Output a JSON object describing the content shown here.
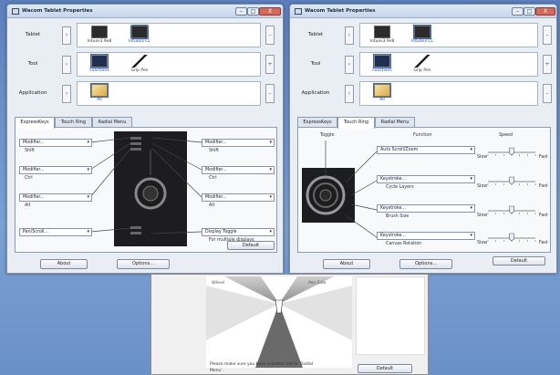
{
  "window_a": {
    "title": "Wacom Tablet Properties",
    "ctrl_min": "–",
    "ctrl_max": "□",
    "ctrl_close": "X",
    "row_labels": [
      "Tablet",
      "Tool",
      "Application"
    ],
    "tablet_items": [
      "Intuos3 9x8",
      "Intuos3 CL"
    ],
    "tool_items": [
      "Functions",
      "Grip Pen"
    ],
    "app_items": [
      "All"
    ],
    "tabs": [
      "ExpressKeys",
      "Touch Ring",
      "Radial Menu"
    ],
    "left_dropdowns": [
      {
        "value": "Modifier...",
        "sub": "Shift"
      },
      {
        "value": "Modifier...",
        "sub": "Ctrl"
      },
      {
        "value": "Modifier...",
        "sub": "Alt"
      },
      {
        "value": "Pan/Scroll...",
        "sub": ""
      }
    ],
    "right_dropdowns": [
      {
        "value": "Modifier...",
        "sub": "Shift"
      },
      {
        "value": "Modifier...",
        "sub": "Ctrl"
      },
      {
        "value": "Modifier...",
        "sub": "Alt"
      },
      {
        "value": "Display Toggle",
        "sub": "For multiple displays"
      }
    ],
    "default_label": "Default",
    "about_label": "About",
    "options_label": "Options..."
  },
  "window_b": {
    "title": "Wacom Tablet Properties",
    "ctrl_min": "–",
    "ctrl_max": "□",
    "ctrl_close": "X",
    "row_labels": [
      "Tablet",
      "Tool",
      "Application"
    ],
    "tablet_items": [
      "Intuos3 9x8",
      "Intuos3 CL"
    ],
    "tool_items": [
      "Functions",
      "Grip Pen"
    ],
    "app_items": [
      "All"
    ],
    "tabs": [
      "ExpressKeys",
      "Touch Ring",
      "Radial Menu"
    ],
    "col_toggle": "Toggle",
    "col_function": "Function",
    "col_speed": "Speed",
    "functions": [
      {
        "value": "Auto Scroll/Zoom",
        "sub": ""
      },
      {
        "value": "Keystroke...",
        "sub": "Cycle Layers"
      },
      {
        "value": "Keystroke...",
        "sub": "Brush Size"
      },
      {
        "value": "Keystroke...",
        "sub": "Canvas Rotation"
      }
    ],
    "slow_label": "Slow",
    "fast_label": "Fast",
    "speed_levels": [
      0.5,
      0.5,
      0.5,
      0.5
    ],
    "default_label": "Default",
    "about_label": "About",
    "options_label": "Options..."
  },
  "wizard": {
    "left_label": "Wheel",
    "right_label": "Pen Side",
    "bottom_label": "",
    "text_line1": "Please make sure you have a button set to 'Radial",
    "text_line2": "Menu'.",
    "default_label": "Default"
  }
}
